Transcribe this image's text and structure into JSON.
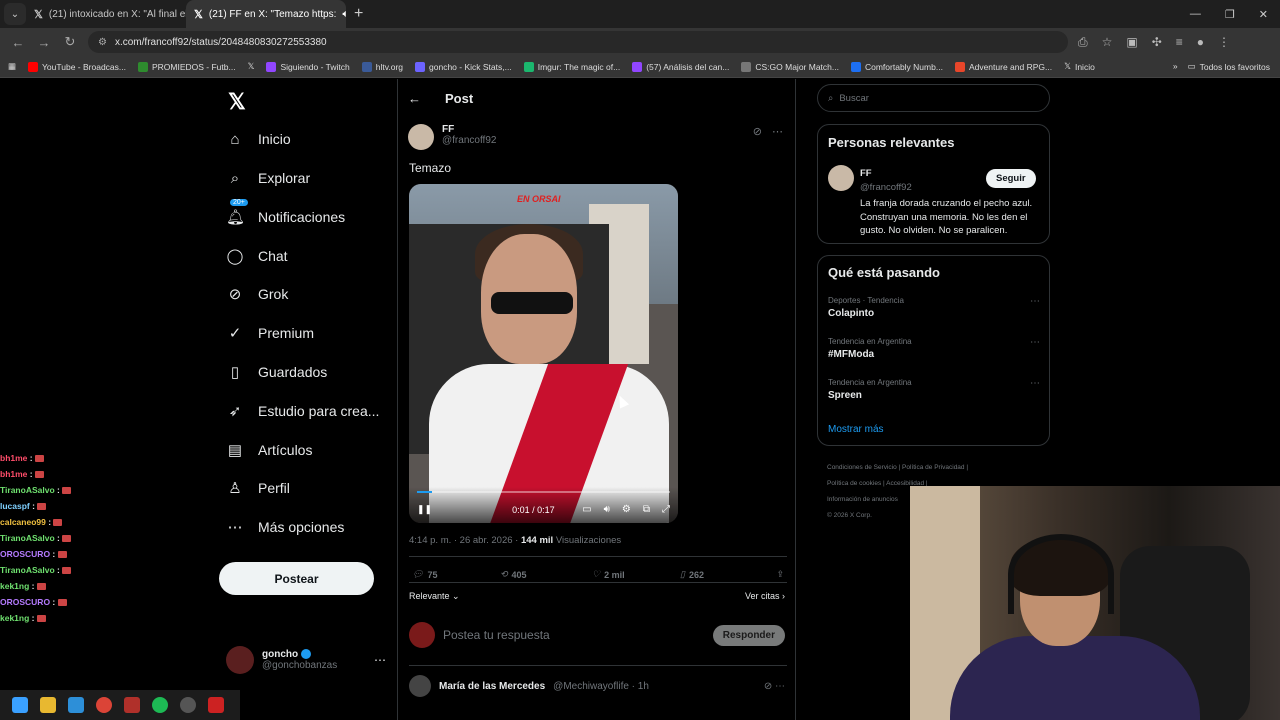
{
  "browser": {
    "tabs": [
      {
        "label": "(21) intoxicado en X: \"Al final el",
        "active": false
      },
      {
        "label": "(21) FF en X: \"Temazo https:",
        "active": true
      }
    ],
    "url": "x.com/francoff92/status/2048480830272553380",
    "bookmarks": [
      {
        "label": "YouTube - Broadcas...",
        "color": "#ff0000"
      },
      {
        "label": "PROMIEDOS - Futb...",
        "color": "#2e8b2e"
      },
      {
        "label": "",
        "color": "#ffffff"
      },
      {
        "label": "Siguiendo - Twitch",
        "color": "#9146ff"
      },
      {
        "label": "hltv.org",
        "color": "#3a5a98"
      },
      {
        "label": "goncho - Kick Stats,...",
        "color": "#6c63ff"
      },
      {
        "label": "Imgur: The magic of...",
        "color": "#1bb76e"
      },
      {
        "label": "(57) Análisis del can...",
        "color": "#9146ff"
      },
      {
        "label": "CS:GO Major Match...",
        "color": "#777777"
      },
      {
        "label": "Comfortably Numb...",
        "color": "#1d6ff2"
      },
      {
        "label": "Adventure and RPG...",
        "color": "#e8462a"
      },
      {
        "label": "Inicio",
        "color": "#ffffff"
      }
    ],
    "bookmarks_right": "Todos los favoritos"
  },
  "nav": {
    "items": [
      {
        "label": "Inicio",
        "icon": "⌂",
        "name": "home-icon"
      },
      {
        "label": "Explorar",
        "icon": "⌕",
        "name": "search-icon"
      },
      {
        "label": "Notificaciones",
        "icon": "♫",
        "name": "bell-icon"
      },
      {
        "label": "Chat",
        "icon": "◯",
        "name": "chat-icon"
      },
      {
        "label": "Grok",
        "icon": "⊘",
        "name": "grok-icon"
      },
      {
        "label": "Premium",
        "icon": "✓",
        "name": "premium-icon"
      },
      {
        "label": "Guardados",
        "icon": "▯",
        "name": "bookmark-icon"
      },
      {
        "label": "Estudio para crea...",
        "icon": "➶",
        "name": "rocket-icon"
      },
      {
        "label": "Artículos",
        "icon": "▤",
        "name": "articles-icon"
      },
      {
        "label": "Perfil",
        "icon": "♙",
        "name": "profile-icon"
      },
      {
        "label": "Más opciones",
        "icon": "⋯",
        "name": "more-icon"
      }
    ],
    "notif_badge": "20+",
    "post_button": "Postear",
    "profile": {
      "name": "goncho",
      "handle": "@gonchobanzas"
    }
  },
  "post": {
    "header": "Post",
    "author_name": "FF",
    "author_handle": "@francoff92",
    "text": "Temazo",
    "video_overlay": "EN ORSAI",
    "video_time": "0:01 / 0:17",
    "video_progress": 0.06,
    "timestamp": "4:14 p. m. · 26 abr. 2026 · ",
    "views_count": "144 mil",
    "views_label": " Visualizaciones",
    "replies": "75",
    "reposts": "405",
    "likes": "2 mil",
    "bookmarks": "262",
    "sort_label": "Relevante",
    "quotes_label": "Ver citas",
    "reply_placeholder": "Postea tu respuesta",
    "reply_button": "Responder",
    "next_reply_name": "María de las Mercedes",
    "next_reply_handle": "@Mechiwayoflife · 1h"
  },
  "sidebar": {
    "search_placeholder": "Buscar",
    "relevant_title": "Personas relevantes",
    "relevant_name": "FF",
    "relevant_handle": "@francoff92",
    "follow_label": "Seguir",
    "relevant_bio": "La franja dorada cruzando el pecho azul. Construyan una memoria. No les den el gusto. No olviden. No se paralicen.",
    "trending_title": "Qué está pasando",
    "trends": [
      {
        "category": "Deportes · Tendencia",
        "topic": "Colapinto"
      },
      {
        "category": "Tendencia en Argentina",
        "topic": "#MFModa"
      },
      {
        "category": "Tendencia en Argentina",
        "topic": "Spreen"
      }
    ],
    "show_more": "Mostrar más",
    "footer_line1": "Condiciones de Servicio  |  Política de Privacidad  |",
    "footer_line2": "Política de cookies  |  Accesibilidad  |",
    "footer_line3": "Información de anuncios",
    "footer_line4": "© 2026 X Corp."
  },
  "chat": [
    {
      "user": "bh1me",
      "color": "#ff4d6a"
    },
    {
      "user": "bh1me",
      "color": "#ff4d6a"
    },
    {
      "user": "TiranoASalvo",
      "color": "#6fe06f"
    },
    {
      "user": "lucaspf",
      "color": "#7fd0ff"
    },
    {
      "user": "calcaneo99",
      "color": "#f0c040"
    },
    {
      "user": "TiranoASalvo",
      "color": "#6fe06f"
    },
    {
      "user": "OROSCURO",
      "color": "#b57bff"
    },
    {
      "user": "TiranoASalvo",
      "color": "#6fe06f"
    },
    {
      "user": "kek1ng",
      "color": "#6fe06f"
    },
    {
      "user": "OROSCURO",
      "color": "#b57bff"
    },
    {
      "user": "kek1ng",
      "color": "#6fe06f"
    }
  ],
  "colors": {
    "accent": "#1d9bf0",
    "background": "#000000",
    "border": "#2f3336"
  }
}
